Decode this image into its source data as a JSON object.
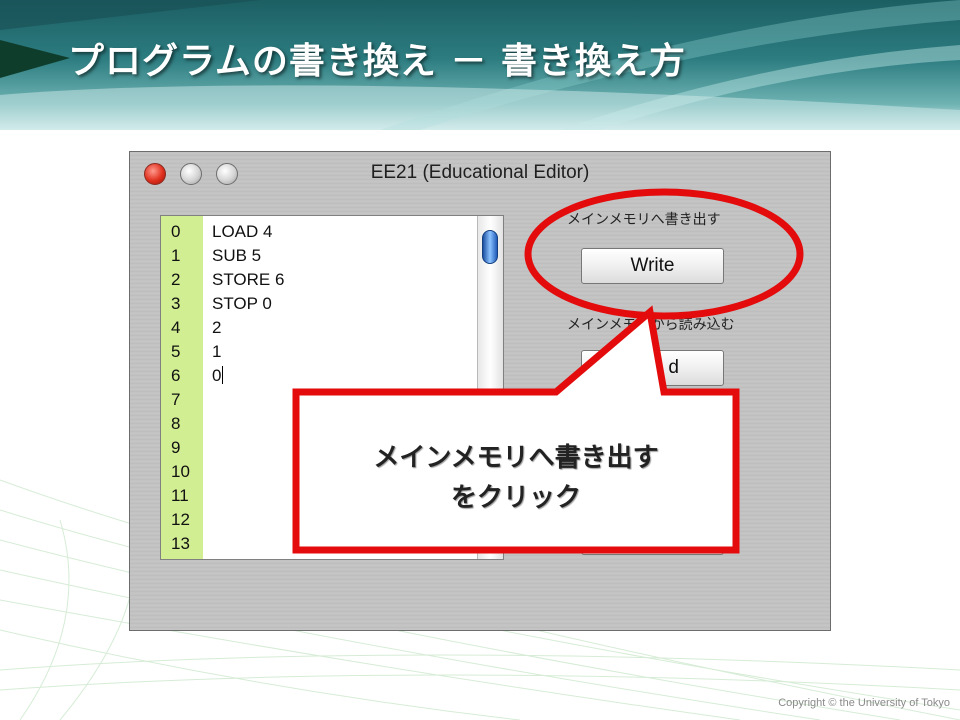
{
  "slide": {
    "title": "プログラムの書き換え － 書き換え方",
    "copyright": "Copyright © the University of Tokyo"
  },
  "window": {
    "title": "EE21 (Educational Editor)",
    "controls": [
      "close-button",
      "minimize-button",
      "zoom-button"
    ]
  },
  "editor": {
    "line_numbers": [
      "0",
      "1",
      "2",
      "3",
      "4",
      "5",
      "6",
      "7",
      "8",
      "9",
      "10",
      "11",
      "12",
      "13"
    ],
    "lines": [
      "LOAD 4",
      "SUB 5",
      "STORE 6",
      "STOP 0",
      "2",
      "1",
      "0",
      "",
      "",
      "",
      "",
      "",
      "",
      ""
    ],
    "caret_line": 6
  },
  "panel": {
    "write_label": "メインメモリへ書き出す",
    "write_button": "Write",
    "read_label": "メインメモリから読み込む",
    "read_button_partial": "d"
  },
  "callout": {
    "line1": "メインメモリへ書き出す",
    "line2": "をクリック"
  },
  "colors": {
    "highlight": "#e30b0b",
    "gutter": "#d2ee92",
    "header": "#2c7c80"
  }
}
